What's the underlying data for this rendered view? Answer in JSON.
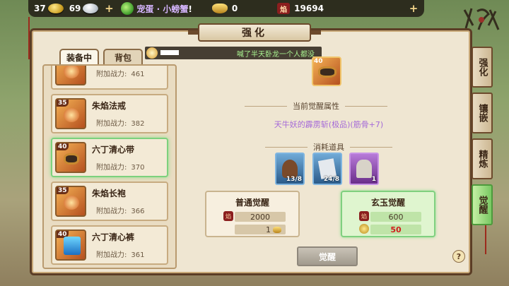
{
  "topbar": {
    "gold_count": "37",
    "silver_count": "69",
    "pet_label": "宠蛋 · 小螃蟹",
    "pet_exclaim": "!",
    "ingot_count": "0",
    "seal_glyph": "焰",
    "seal_count": "19694",
    "plus_glyph": "+"
  },
  "panel": {
    "title": "强化"
  },
  "left_tabs": [
    {
      "label": "装备中"
    },
    {
      "label": "背包"
    }
  ],
  "items": [
    {
      "level": "",
      "name": "",
      "power_label": "附加战力:",
      "power": "461"
    },
    {
      "level": "35",
      "name": "朱焰法戒",
      "power_label": "附加战力:",
      "power": "382"
    },
    {
      "level": "40",
      "name": "六丁清心带",
      "power_label": "附加战力:",
      "power": "370"
    },
    {
      "level": "35",
      "name": "朱焰长袍",
      "power_label": "附加战力:",
      "power": "366"
    },
    {
      "level": "40",
      "name": "六丁清心裤",
      "power_label": "附加战力:",
      "power": "361"
    }
  ],
  "banner": {
    "text": "喊了半天卧龙一个人都没"
  },
  "current_item": {
    "level": "40"
  },
  "awaken": {
    "attr_heading": "当前觉醒属性",
    "attr_text": "天牛妖的霹雳斩(极品)(筋骨+7)",
    "materials_heading": "消耗道具",
    "materials": [
      {
        "count": "13/8"
      },
      {
        "count": "24/8"
      },
      {
        "count": "1"
      }
    ],
    "normal": {
      "title": "普通觉醒",
      "cost_seal": "2000",
      "cost_ingot": "1"
    },
    "jade": {
      "title": "玄玉觉醒",
      "cost_seal": "600",
      "cost_ingot": "50"
    },
    "button_label": "觉醒",
    "help_glyph": "?"
  },
  "side_tabs": [
    {
      "label": "强化"
    },
    {
      "label": "镶嵌"
    },
    {
      "label": "精炼"
    },
    {
      "label": "觉醒"
    }
  ],
  "colors": {
    "accent_green": "#7dd17d",
    "attr_purple": "#a56ad8",
    "cost_red": "#d11d1d"
  }
}
